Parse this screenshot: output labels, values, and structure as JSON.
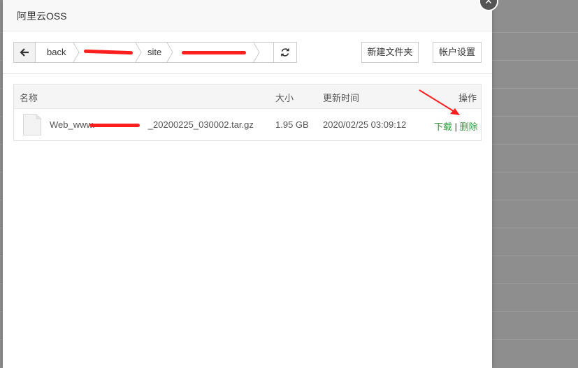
{
  "dialog": {
    "title": "阿里云OSS"
  },
  "toolbar": {
    "breadcrumb": [
      "back",
      "",
      "site",
      ""
    ],
    "new_folder_label": "新建文件夹",
    "account_settings_label": "帐户设置"
  },
  "table": {
    "headers": {
      "name": "名称",
      "size": "大小",
      "updated": "更新时间",
      "actions": "操作"
    },
    "rows": [
      {
        "name_prefix": "Web_www.",
        "name_suffix": "_20200225_030002.tar.gz",
        "size": "1.95 GB",
        "updated": "2020/02/25 03:09:12",
        "download": "下载",
        "separator": "|",
        "delete": "删除"
      }
    ]
  },
  "colors": {
    "action_link": "#2a9d3a",
    "annotation": "#ff1f1f"
  },
  "icons": [
    "close-icon",
    "back-arrow-icon",
    "refresh-icon",
    "file-icon",
    "breadcrumb-chevron-icon"
  ]
}
